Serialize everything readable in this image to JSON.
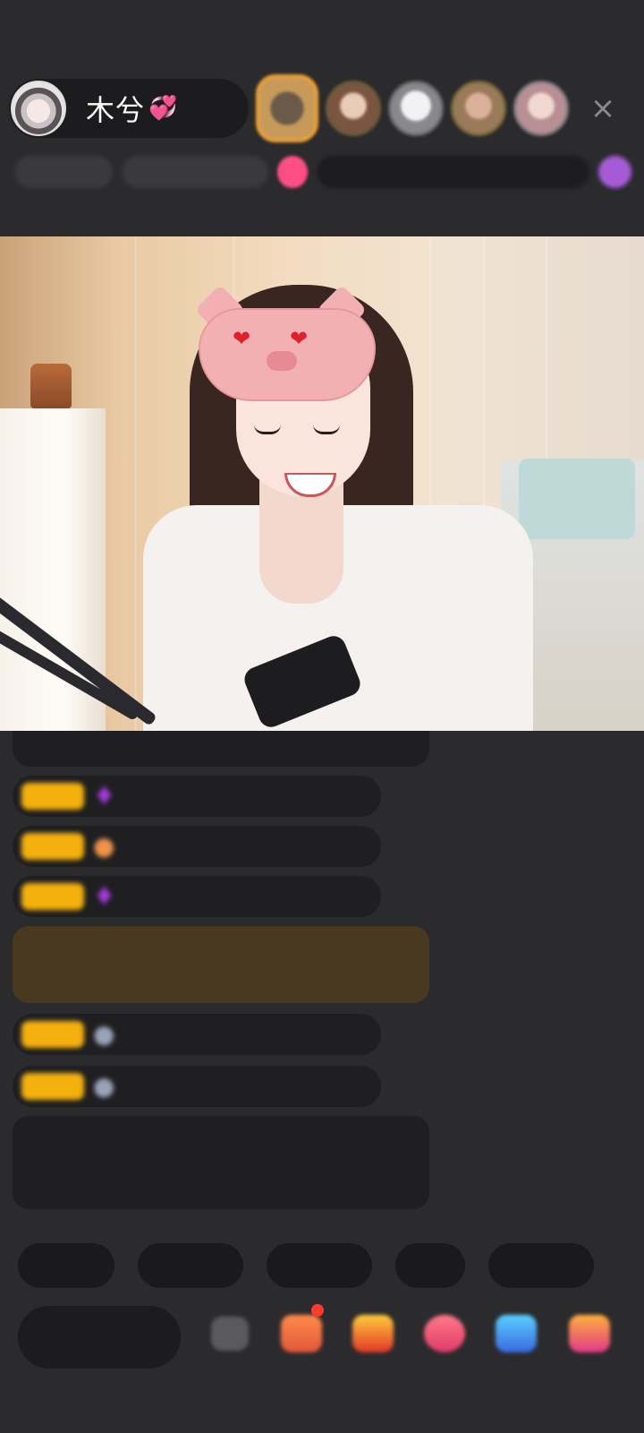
{
  "header": {
    "host_name": "木兮",
    "host_heart": "💞",
    "close_icon": "×"
  },
  "info_row": {
    "items": [
      "",
      "",
      "",
      ""
    ]
  },
  "video": {
    "description_icon": "live-stream-video"
  },
  "chat": {
    "first_message": "",
    "messages": [
      {
        "level": "",
        "badge_icon": "diamond-badge-icon",
        "user": "",
        "text": ""
      },
      {
        "level": "",
        "badge_icon": "shield-badge-icon",
        "user": "",
        "text": ""
      },
      {
        "level": "",
        "badge_icon": "diamond-badge-icon",
        "user": "",
        "text": ""
      },
      {
        "level": "",
        "badge_icon": "avatar-badge-icon",
        "user": "",
        "text": ""
      },
      {
        "level": "",
        "badge_icon": "avatar-badge-icon",
        "user": "",
        "text": ""
      }
    ],
    "highlight_text": "",
    "notice_text": ""
  },
  "quick_replies": [
    "",
    "",
    "",
    "",
    ""
  ],
  "bottom_bar": {
    "input_placeholder": "",
    "icons": [
      "more-icon",
      "gift-box-icon",
      "treasure-icon",
      "heart-icon",
      "game-icon",
      "gift-icon"
    ]
  },
  "colors": {
    "background": "#2b2b2d",
    "level_badge": "#f4b10e",
    "highlight": "#4a3921",
    "notice_text": "#9ecb6d"
  }
}
